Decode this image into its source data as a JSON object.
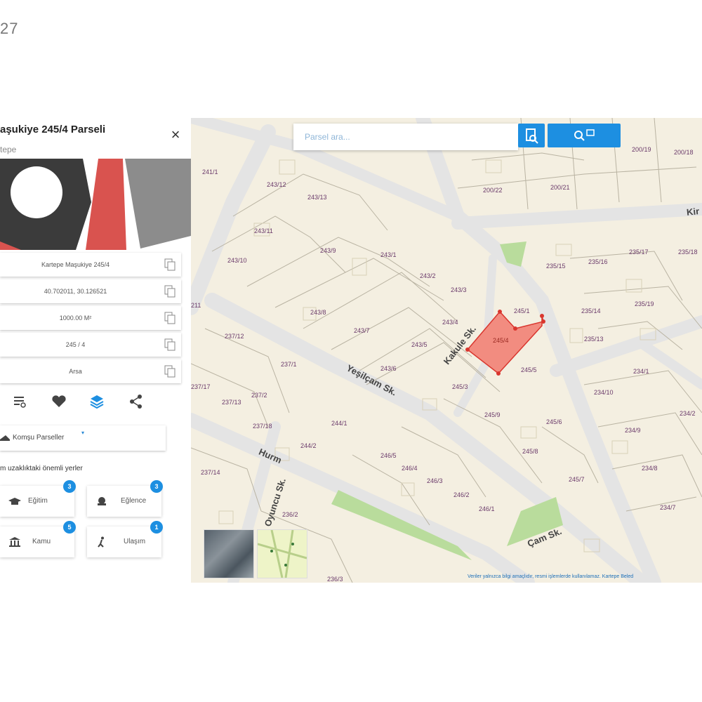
{
  "page_corner_number": "27",
  "panel": {
    "title": "aşukiye 245/4 Parseli",
    "subtitle": "tepe",
    "close_glyph": "×",
    "rows": [
      {
        "value": "Kartepe Maşukiye 245/4"
      },
      {
        "value": "40.702011, 30.126521"
      },
      {
        "value": "1000.00 M²"
      },
      {
        "value": "245 / 4"
      },
      {
        "value": "Arsa"
      }
    ],
    "actions": [
      "list-settings-icon",
      "heart-icon",
      "layers-icon",
      "share-icon"
    ],
    "neighbors_label": "Komşu Parseller",
    "nearby_title": "m uzaklıktaki önemli yerler",
    "categories": [
      {
        "label": "Eğitim",
        "count": "3",
        "icon": "graduation-cap-icon"
      },
      {
        "label": "Eğlence",
        "count": "3",
        "icon": "entertainment-icon"
      },
      {
        "label": "Kamu",
        "count": "5",
        "icon": "building-icon"
      },
      {
        "label": "Ulaşım",
        "count": "1",
        "icon": "walking-icon"
      }
    ],
    "accent_color": "#1d8fe1"
  },
  "map": {
    "search_placeholder": "Parsel ara...",
    "disclaimer": "Veriler yalnızca bilgi amaçlıdır, resmi işlemlerde kullanılamaz. Kartepe Beled",
    "selected_parcel": "245/4",
    "selected_color": "#f28c80",
    "streets": [
      "Yeşilçam Sk.",
      "Kakule Sk.",
      "Hurm",
      "Oyuncu Sk.",
      "Kir",
      "Çam Sk."
    ],
    "parcels": [
      "241/1",
      "243/12",
      "243/13",
      "243/11",
      "243/10",
      "243/9",
      "243/1",
      "243/2",
      "243/3",
      "243/4",
      "243/5",
      "243/6",
      "243/7",
      "243/8",
      "245/1",
      "245/3",
      "245/5",
      "245/6",
      "245/7",
      "245/8",
      "245/9",
      "246/1",
      "246/2",
      "246/3",
      "246/4",
      "246/5",
      "244/1",
      "244/2",
      "237/1",
      "237/2",
      "237/12",
      "237/13",
      "237/14",
      "237/17",
      "237/18",
      "236/2",
      "236/3",
      "234/1",
      "234/2",
      "234/7",
      "234/8",
      "234/9",
      "234/10",
      "235/13",
      "235/14",
      "235/15",
      "235/16",
      "235/17",
      "235/18",
      "235/19",
      "200/18",
      "200/19",
      "200/21",
      "200/22",
      "211"
    ]
  }
}
